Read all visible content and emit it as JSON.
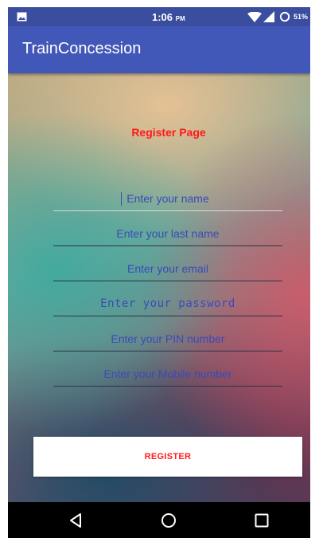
{
  "status_bar": {
    "time": "1:06",
    "time_suffix": "PM",
    "battery_percent": "51%"
  },
  "app_bar": {
    "title": "TrainConcession"
  },
  "form": {
    "heading": "Register Page",
    "fields": [
      {
        "placeholder": "Enter your name"
      },
      {
        "placeholder": "Enter your last name"
      },
      {
        "placeholder": "Enter your email"
      },
      {
        "placeholder": "Enter your password"
      },
      {
        "placeholder": "Enter your PIN number"
      },
      {
        "placeholder": "Enter your Mobile number"
      }
    ],
    "submit_label": "REGISTER"
  },
  "colors": {
    "status_bar": "#3a4d9f",
    "app_bar": "#4258b8",
    "accent_red": "#ff1a1a",
    "hint_text": "#3b4ab8"
  }
}
